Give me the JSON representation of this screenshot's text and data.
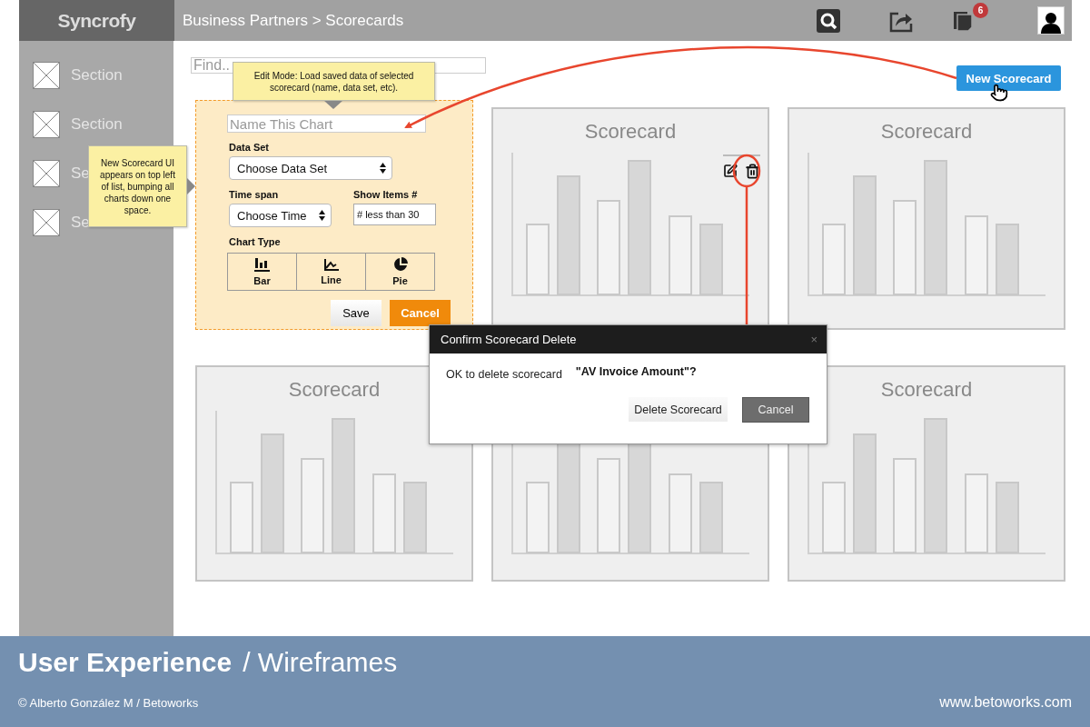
{
  "header": {
    "logo": "Syncrofy",
    "breadcrumb": "Business Partners > Scorecards",
    "notification_count": "6"
  },
  "sidebar": {
    "items": [
      {
        "label": "Section"
      },
      {
        "label": "Section"
      },
      {
        "label": "Se"
      },
      {
        "label": "Se"
      }
    ]
  },
  "search": {
    "placeholder": "Find.."
  },
  "new_button": "New Scorecard",
  "notes": {
    "edit_mode": "Edit Mode: Load saved data of selected scorecard (name, data set, etc).",
    "new_ui": "New Scorecard UI appears on top left of list, bumping all charts down one space."
  },
  "editor": {
    "name_placeholder": "Name This Chart",
    "data_set_label": "Data Set",
    "data_set_value": "Choose Data Set",
    "time_label": "Time span",
    "time_value": "Choose Time",
    "items_label": "Show Items #",
    "items_value": "# less than 30",
    "chart_type_label": "Chart Type",
    "chart_types": [
      {
        "label": "Bar",
        "kind": "bar"
      },
      {
        "label": "Line",
        "kind": "line"
      },
      {
        "label": "Pie",
        "kind": "pie"
      }
    ],
    "save": "Save",
    "cancel": "Cancel"
  },
  "cards": [
    {
      "kind": "bar",
      "title": "Scorecard",
      "actions": true
    },
    {
      "kind": "bar",
      "title": "Scorecard",
      "actions": false
    },
    {
      "kind": "bar",
      "title": "Scorecard",
      "actions": false
    },
    {
      "kind": "bar"
    },
    {
      "kind": "bar",
      "title": "Scorecard",
      "actions": false
    }
  ],
  "dialog": {
    "title": "Confirm Scorecard Delete",
    "close": "×",
    "message": "OK to delete scorecard",
    "item": "\"AV Invoice Amount\"?",
    "confirm": "Delete Scorecard",
    "cancel": "Cancel"
  },
  "footer": {
    "title": "User Experience",
    "subtitle": "/ Wireframes",
    "credit": "© Alberto González M / Betoworks",
    "url": "www.betoworks.com"
  }
}
